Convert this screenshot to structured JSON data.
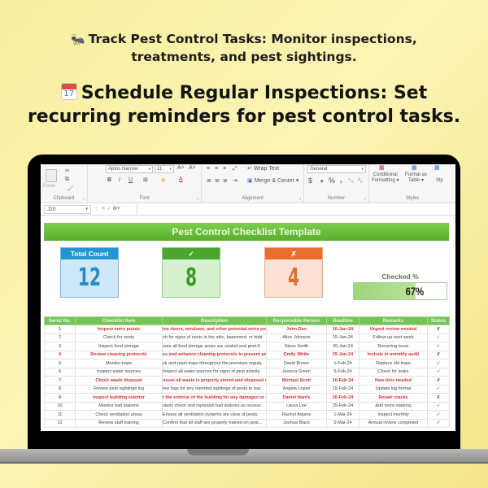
{
  "promo": {
    "line1_icon": "bug-icon",
    "line1": "Track Pest Control Tasks: Monitor inspections, treatments, and pest sightings.",
    "line1_a": "Track Pest Control Tasks: Monitor inspections,",
    "line1_b": "treatments, and pest sightings.",
    "line2_icon": "calendar-icon",
    "calendar_day": "17",
    "line2_a": "Schedule Regular Inspections: Set",
    "line2_b": "recurring reminders for pest control tasks."
  },
  "ribbon": {
    "clipboard": {
      "paste": "Paste",
      "label": "Clipboard"
    },
    "font": {
      "name": "Aptos Narrow",
      "size": "11",
      "bold": "B",
      "italic": "I",
      "underline": "U",
      "label": "Font"
    },
    "alignment": {
      "wrap_text": "Wrap Text",
      "merge_center": "Merge & Center",
      "label": "Alignment"
    },
    "number": {
      "format": "General",
      "currency": "$",
      "percent": "%",
      "comma": ",",
      "label": "Number"
    },
    "styles": {
      "conditional_formatting_a": "Conditional",
      "conditional_formatting_b": "Formatting",
      "format_as_table_a": "Format as",
      "format_as_table_b": "Table",
      "cell_styles": "Sty",
      "label": "Styles"
    }
  },
  "formula_bar": {
    "name_box": "J10",
    "fx": "fx",
    "value": ""
  },
  "sheet": {
    "title": "Pest Control Checklist Template",
    "kpis": {
      "total": {
        "label": "Total Count",
        "value": "12",
        "color": "#2196d3"
      },
      "checked": {
        "label": "✓",
        "value": "8",
        "color": "#4ca52c"
      },
      "unchecked": {
        "label": "✗",
        "value": "4",
        "color": "#e96e2e"
      }
    },
    "checked_pct": {
      "label": "Checked %",
      "value": 67,
      "text": "67%"
    },
    "columns": [
      "Serial No.",
      "Checklist Item",
      "Description",
      "Responsible Person",
      "Deadline",
      "Remarks",
      "Status"
    ],
    "rows": [
      {
        "serial": "1",
        "item": "Inspect entry points",
        "desc": "ine doors, windows, and other potential entry po",
        "person": "John Doe",
        "deadline": "10-Jan-24",
        "remarks": "Urgent review needed",
        "status": "✗",
        "flag": true
      },
      {
        "serial": "2",
        "item": "Check for nests",
        "desc": "ch for signs of nests in the attic, basement, or hidd",
        "person": "Alice Johnson",
        "deadline": "15-Jan-24",
        "remarks": "Follow-up next week",
        "status": "✓",
        "flag": false
      },
      {
        "serial": "3",
        "item": "Inspect food storage",
        "desc": "sure all food storage areas are sealed and pest-fr",
        "person": "Steve Smith",
        "deadline": "20-Jan-24",
        "remarks": "Recurring issue",
        "status": "✓",
        "flag": false
      },
      {
        "serial": "4",
        "item": "Review cleaning protocols",
        "desc": "ss and enhance cleaning protocols to prevent pe",
        "person": "Emily White",
        "deadline": "25-Jan-24",
        "remarks": "Include in monthly audit",
        "status": "✗",
        "flag": true
      },
      {
        "serial": "5",
        "item": "Monitor traps",
        "desc": "ck and reset traps throughout the premises regula",
        "person": "David Brown",
        "deadline": "1-Feb-24",
        "remarks": "Replace old traps",
        "status": "✓",
        "flag": false
      },
      {
        "serial": "6",
        "item": "Inspect water sources",
        "desc": "Inspect all water sources for signs of pest activity.",
        "person": "Jessica Green",
        "deadline": "5-Feb-24",
        "remarks": "Check for leaks",
        "status": "✓",
        "flag": false
      },
      {
        "serial": "7",
        "item": "Check waste disposal",
        "desc": "nsure all waste is properly stored and disposed o",
        "person": "Michael Scott",
        "deadline": "10-Feb-24",
        "remarks": "New bins needed",
        "status": "✗",
        "flag": true
      },
      {
        "serial": "8",
        "item": "Review pest sightings log",
        "desc": "iew logs for any reported sightings of pests to trac",
        "person": "Angela Lopez",
        "deadline": "15-Feb-24",
        "remarks": "Update log format",
        "status": "✓",
        "flag": false
      },
      {
        "serial": "9",
        "item": "Inspect building exterior",
        "desc": "t the exterior of the building for any damages or o",
        "person": "Daniel Harris",
        "deadline": "20-Feb-24",
        "remarks": "Repair cracks",
        "status": "✗",
        "flag": true
      },
      {
        "serial": "10",
        "item": "Monitor bait stations",
        "desc": "ularly check and replenish bait stations as necess",
        "person": "Laura Lee",
        "deadline": "25-Feb-24",
        "remarks": "Add more stations",
        "status": "✓",
        "flag": false
      },
      {
        "serial": "11",
        "item": "Check ventilation areas",
        "desc": "Ensure all ventilation systems are clear of pests.",
        "person": "Rachel Adams",
        "deadline": "1-Mar-24",
        "remarks": "Inspect monthly",
        "status": "✓",
        "flag": false
      },
      {
        "serial": "12",
        "item": "Review staff training",
        "desc": "Confirm that all staff are properly trained on pest...",
        "person": "Joshua Black",
        "deadline": "5-Mar-24",
        "remarks": "Annual review completed",
        "status": "✓",
        "flag": false
      }
    ]
  }
}
